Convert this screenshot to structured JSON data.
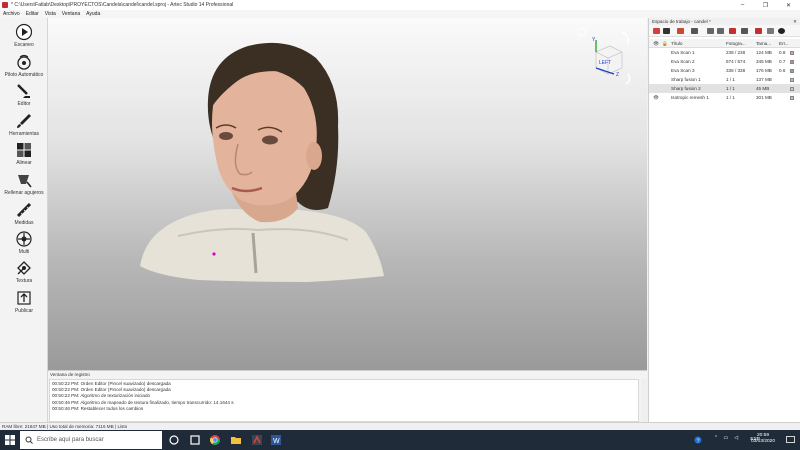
{
  "window": {
    "title": "* C:\\Users\\Fatlab\\Desktop\\PROYECTOS\\Candela\\candel\\candel.sproj - Artec Studio 14 Professional",
    "controls": [
      "–",
      "❐",
      "✕"
    ]
  },
  "menu": [
    "Archivo",
    "Editar",
    "Vista",
    "Ventana",
    "Ayuda"
  ],
  "tools": [
    {
      "label": "Escaneo",
      "icon": "play-icon"
    },
    {
      "label": "Piloto Automático",
      "icon": "autopilot-icon"
    },
    {
      "label": "Editor",
      "icon": "eraser-icon"
    },
    {
      "label": "Herramientas",
      "icon": "brush-icon"
    },
    {
      "label": "Alinear",
      "icon": "align-icon"
    },
    {
      "label": "Rellenar agujeros",
      "icon": "fill-holes-icon"
    },
    {
      "label": "Medidas",
      "icon": "ruler-icon"
    },
    {
      "label": "Multi",
      "icon": "multi-icon"
    },
    {
      "label": "Textura",
      "icon": "texture-icon"
    },
    {
      "label": "Publicar",
      "icon": "publish-icon"
    }
  ],
  "viewcube": {
    "top_label": "LEFT",
    "axes": [
      "Y",
      "Z"
    ]
  },
  "workspace": {
    "title": "Espacio de trabajo - candel *",
    "columns": {
      "title": "Título",
      "frames": "Fotogra...",
      "size": "Tama...",
      "error": "Err..."
    },
    "rows": [
      {
        "title": "Eva Scan 1",
        "frames": "238 / 238",
        "size": "124 MB",
        "error": "0.8",
        "color": "#d9a0a0",
        "visible": false,
        "selected": false
      },
      {
        "title": "Eva Scan 2",
        "frames": "574 / 574",
        "size": "345 MB",
        "error": "0.7",
        "color": "#c98a8a",
        "visible": false,
        "selected": false
      },
      {
        "title": "Eva Scan 3",
        "frames": "338 / 338",
        "size": "176 MB",
        "error": "0.6",
        "color": "#6fb4a0",
        "visible": false,
        "selected": false
      },
      {
        "title": "Sharp fusion 1",
        "frames": "1 / 1",
        "size": "137 MB",
        "error": "",
        "color": "#d0b0b0",
        "visible": false,
        "selected": false
      },
      {
        "title": "Sharp fusion 2",
        "frames": "1 / 1",
        "size": "45 MB",
        "error": "",
        "color": "#cccccc",
        "visible": false,
        "selected": true
      },
      {
        "title": "Isotropic remesh 1",
        "frames": "1 / 1",
        "size": "301 MB",
        "error": "",
        "color": "#9ed6b0",
        "visible": true,
        "selected": false
      }
    ]
  },
  "log": {
    "title": "Ventana de registro",
    "lines": [
      "00:50:22 PM: Orden Editor (Pincel suavizado) descargada",
      "00:50:22 PM: Orden Editor (Pincel suavizado) descargada",
      "00:50:22 PM: Algoritmo de texturización iniciado",
      "00:50:46 PM: Algoritmo de mapeado de textura finalizado, tiempo transcurrido: 14.1644 s",
      "00:50:46 PM: Restablecer todos los cambios"
    ]
  },
  "status": {
    "ram": "RAM libre: 21847 MB",
    "memory": "Uso total de memoria: 7116 MB",
    "state": "Listo"
  },
  "taskbar": {
    "search_placeholder": "Escribe aquí para buscar",
    "language": "ESP",
    "time": "20:59",
    "date": "03/03/2020",
    "apps": [
      "task-view-icon",
      "widget-icon",
      "chrome-icon",
      "file-explorer-icon",
      "artec-studio-icon",
      "word-icon"
    ]
  },
  "colors": {
    "accent": "#1a3fc8",
    "taskbar": "#1f2b38",
    "marker": "#e000c8"
  }
}
